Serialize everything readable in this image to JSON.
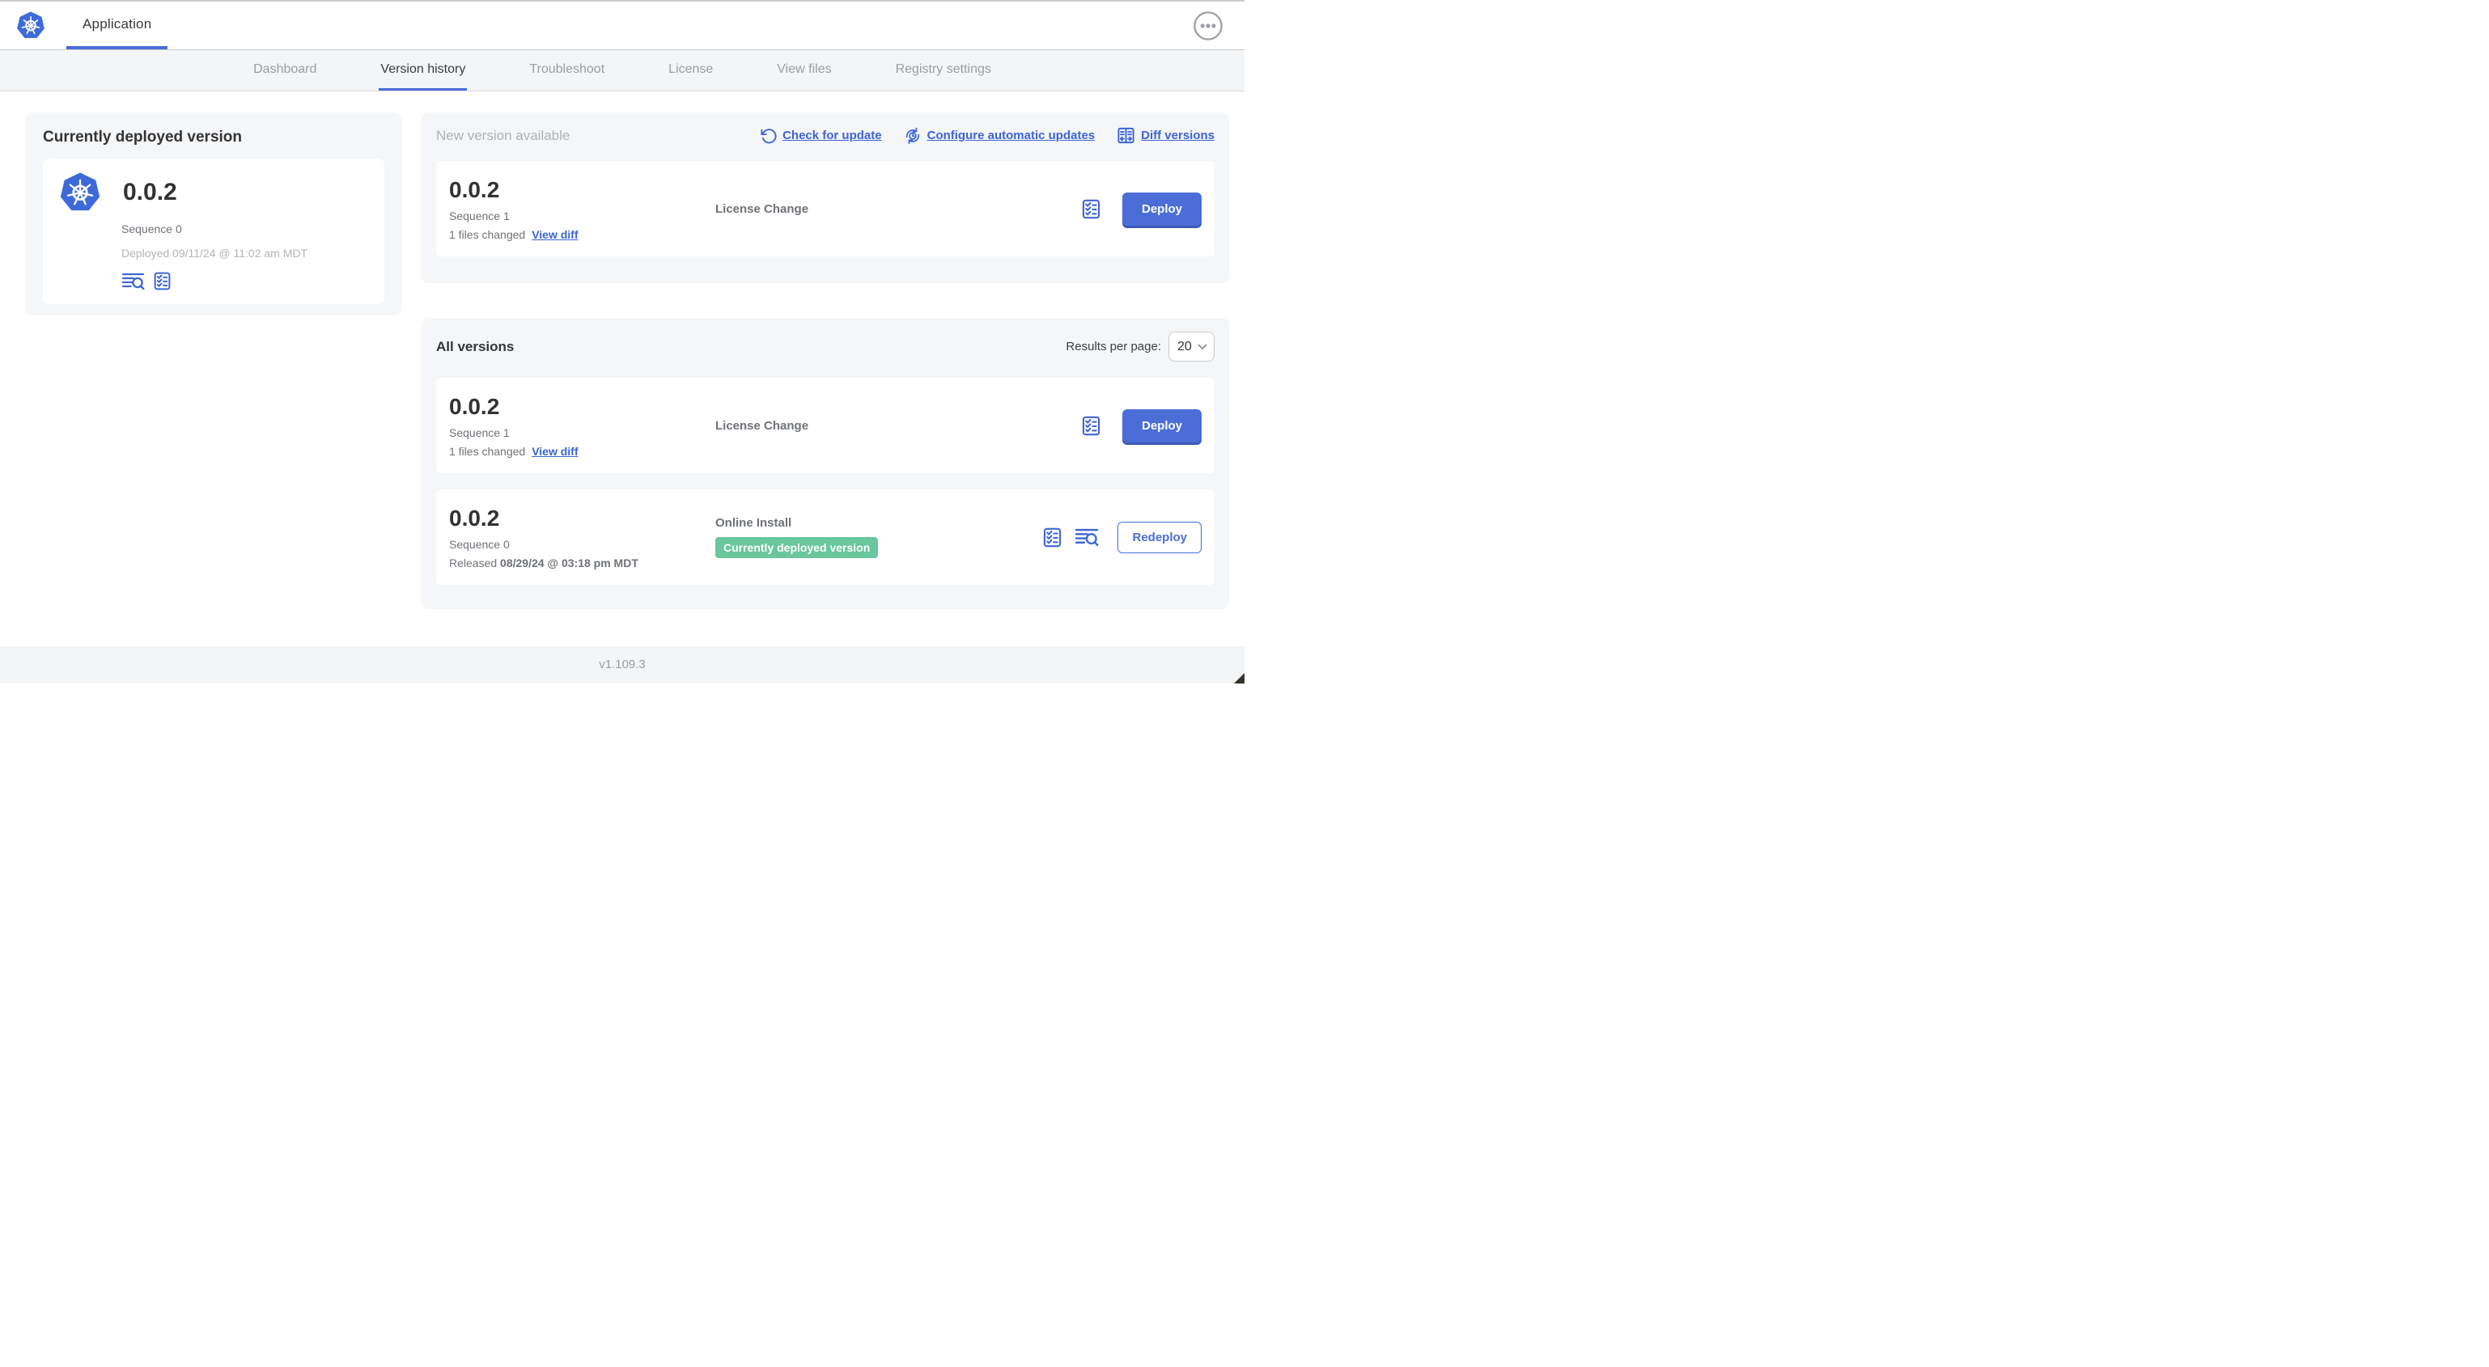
{
  "header": {
    "app_title": "Application"
  },
  "tabs": [
    "Dashboard",
    "Version history",
    "Troubleshoot",
    "License",
    "View files",
    "Registry settings"
  ],
  "active_tab": "Version history",
  "colors": {
    "accent_blue": "#4a6dd8",
    "link_blue": "#3b64d6",
    "badge_green": "#69c69d",
    "logo_blue": "#3e6ad9"
  },
  "currently_deployed": {
    "title": "Currently deployed version",
    "version": "0.0.2",
    "sequence": "Sequence 0",
    "deployed": "Deployed 09/11/24 @ 11:02 am MDT",
    "icons": [
      "logs-icon",
      "checklist-icon"
    ]
  },
  "new_version": {
    "title": "New version available",
    "actions": [
      {
        "icon": "refresh-icon",
        "label": "Check for update"
      },
      {
        "icon": "auto-update-icon",
        "label": "Configure automatic updates"
      },
      {
        "icon": "diff-icon",
        "label": "Diff versions"
      }
    ],
    "row": {
      "version": "0.0.2",
      "sequence": "Sequence 1",
      "files_changed": "1 files changed",
      "view_diff": "View diff",
      "source": "License Change",
      "action": "Deploy"
    }
  },
  "all_versions": {
    "title": "All versions",
    "results_per_page_label": "Results per page:",
    "results_per_page": "20",
    "rows": [
      {
        "version": "0.0.2",
        "sequence": "Sequence 1",
        "files_changed": "1 files changed",
        "view_diff": "View diff",
        "source": "License Change",
        "action": "Deploy"
      },
      {
        "version": "0.0.2",
        "sequence": "Sequence 0",
        "released_prefix": "Released",
        "released_date": "08/29/24 @ 03:18 pm MDT",
        "source": "Online Install",
        "badge": "Currently deployed version",
        "action": "Redeploy"
      }
    ]
  },
  "footer": {
    "version": "v1.109.3"
  }
}
